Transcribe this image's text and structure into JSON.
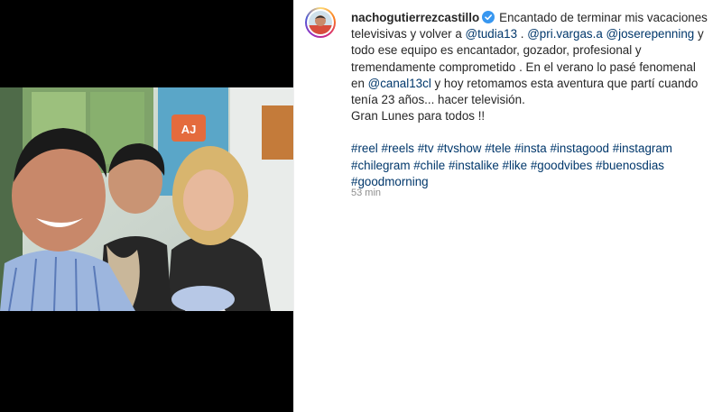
{
  "post": {
    "username": "nachogutierrezcastillo",
    "caption_segments": [
      {
        "type": "text",
        "value": "Encantado de terminar mis vacaciones televisivas y volver a "
      },
      {
        "type": "mention",
        "value": "@tudia13"
      },
      {
        "type": "text",
        "value": " . "
      },
      {
        "type": "mention",
        "value": "@pri.vargas.a"
      },
      {
        "type": "text",
        "value": " "
      },
      {
        "type": "mention",
        "value": "@joserepenning"
      },
      {
        "type": "text",
        "value": " y todo ese equipo es encantador, gozador, profesional y tremendamente comprometido . En el verano lo pasé fenomenal en "
      },
      {
        "type": "mention",
        "value": "@canal13cl"
      },
      {
        "type": "text",
        "value": " y hoy retomamos esta aventura que partí cuando tenía 23 años... hacer televisión."
      },
      {
        "type": "br"
      },
      {
        "type": "text",
        "value": "Gran Lunes para todos !!"
      }
    ],
    "hashtags": [
      "#reel",
      "#reels",
      "#tv",
      "#tvshow",
      "#tele",
      "#insta",
      "#instagood",
      "#instagram",
      "#chilegram",
      "#chile",
      "#instalike",
      "#like",
      "#goodvibes",
      "#buenosdias",
      "#goodmorning"
    ],
    "timestamp": "53 min",
    "photo_signage": "AJ"
  },
  "colors": {
    "link": "#00376b",
    "text": "#262626",
    "muted": "#8e8e8e",
    "verified": "#3897f0"
  },
  "icons": {
    "verified": "verified-badge-icon"
  }
}
